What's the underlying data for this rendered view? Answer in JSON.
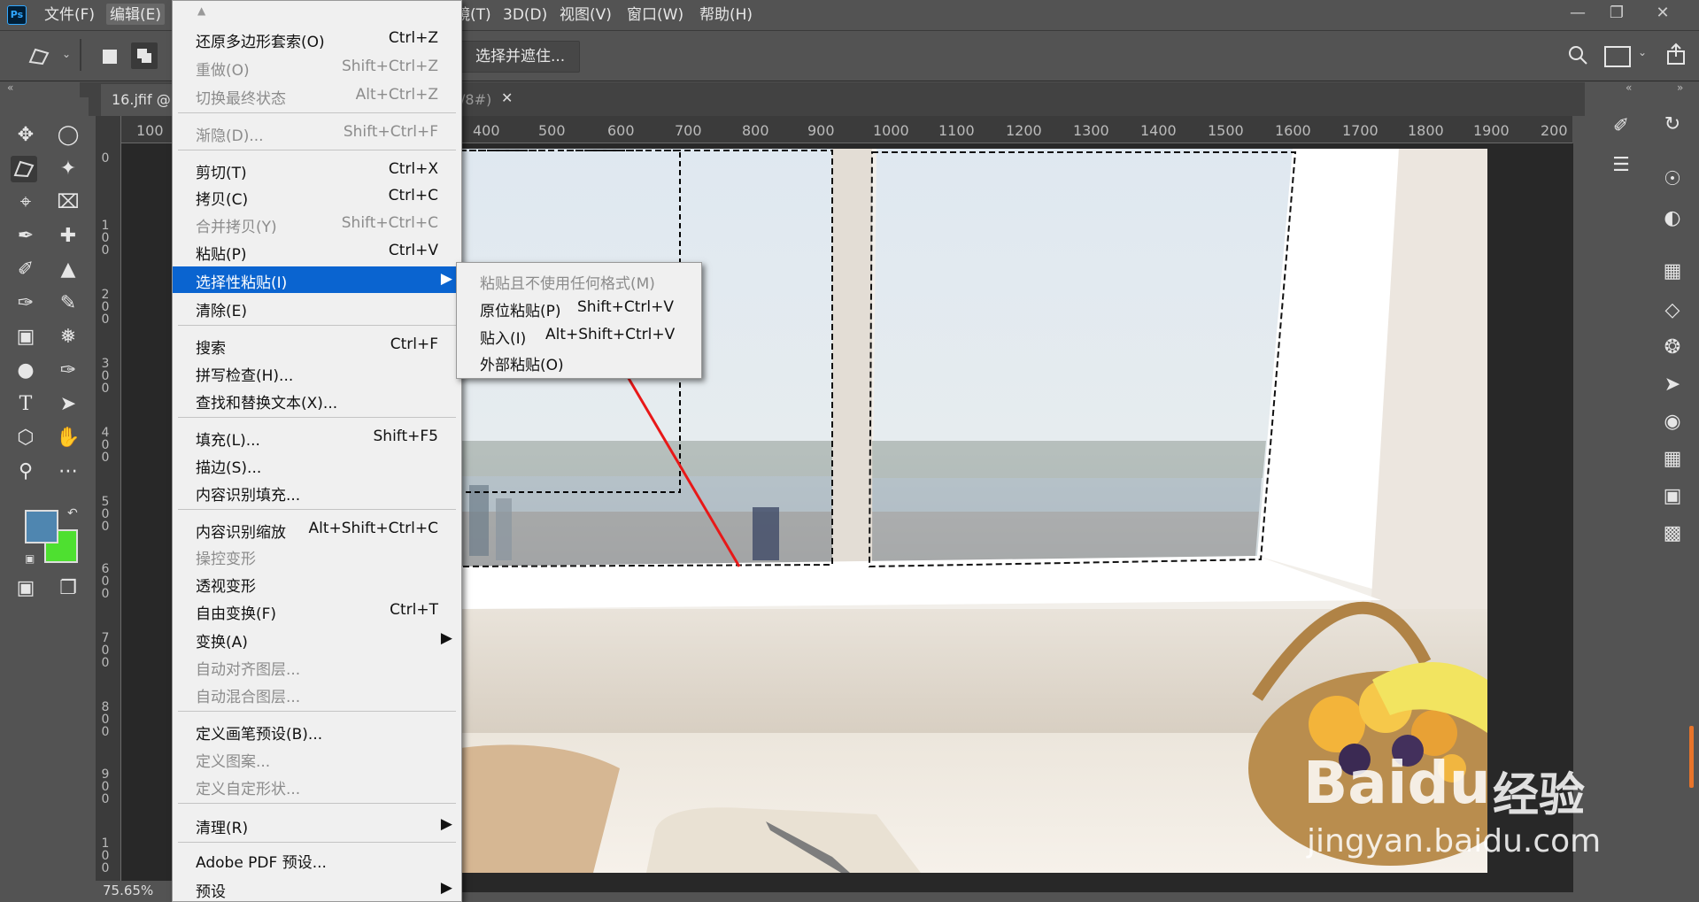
{
  "menubar": {
    "items_left": [
      "文件(F)",
      "编辑(E)"
    ],
    "items_right": [
      "镜(T)",
      "3D(D)",
      "视图(V)",
      "窗口(W)",
      "帮助(H)"
    ]
  },
  "optbar": {
    "select_mask_label": "选择并遮住..."
  },
  "document": {
    "tab_left": "16.jfif @",
    "tab_right": "/8#)",
    "zoom": "75.65%"
  },
  "ruler": {
    "h_ticks": [
      "100",
      "400",
      "500",
      "600",
      "700",
      "800",
      "900",
      "1000",
      "1100",
      "1200",
      "1300",
      "1400",
      "1500",
      "1600",
      "1700",
      "1800",
      "1900",
      "200"
    ],
    "v_ticks": [
      "0",
      "1\n0\n0",
      "2\n0\n0",
      "3\n0\n0",
      "4\n0\n0",
      "5\n0\n0",
      "6\n0\n0",
      "7\n0\n0",
      "8\n0\n0",
      "9\n0\n0",
      "1\n0\n0"
    ]
  },
  "edit_menu": {
    "items": [
      {
        "label": "还原多边形套索(O)",
        "shortcut": "Ctrl+Z"
      },
      {
        "label": "重做(O)",
        "shortcut": "Shift+Ctrl+Z"
      },
      {
        "label": "切换最终状态",
        "shortcut": "Alt+Ctrl+Z"
      },
      {
        "label": "渐隐(D)...",
        "shortcut": "Shift+Ctrl+F"
      },
      {
        "label": "剪切(T)",
        "shortcut": "Ctrl+X"
      },
      {
        "label": "拷贝(C)",
        "shortcut": "Ctrl+C"
      },
      {
        "label": "合并拷贝(Y)",
        "shortcut": "Shift+Ctrl+C"
      },
      {
        "label": "粘贴(P)",
        "shortcut": "Ctrl+V"
      },
      {
        "label": "选择性粘贴(I)",
        "shortcut": ""
      },
      {
        "label": "清除(E)",
        "shortcut": ""
      },
      {
        "label": "搜索",
        "shortcut": "Ctrl+F"
      },
      {
        "label": "拼写检查(H)...",
        "shortcut": ""
      },
      {
        "label": "查找和替换文本(X)...",
        "shortcut": ""
      },
      {
        "label": "填充(L)...",
        "shortcut": "Shift+F5"
      },
      {
        "label": "描边(S)...",
        "shortcut": ""
      },
      {
        "label": "内容识别填充...",
        "shortcut": ""
      },
      {
        "label": "内容识别缩放",
        "shortcut": "Alt+Shift+Ctrl+C"
      },
      {
        "label": "操控变形",
        "shortcut": ""
      },
      {
        "label": "透视变形",
        "shortcut": ""
      },
      {
        "label": "自由变换(F)",
        "shortcut": "Ctrl+T"
      },
      {
        "label": "变换(A)",
        "shortcut": ""
      },
      {
        "label": "自动对齐图层...",
        "shortcut": ""
      },
      {
        "label": "自动混合图层...",
        "shortcut": ""
      },
      {
        "label": "定义画笔预设(B)...",
        "shortcut": ""
      },
      {
        "label": "定义图案...",
        "shortcut": ""
      },
      {
        "label": "定义自定形状...",
        "shortcut": ""
      },
      {
        "label": "清理(R)",
        "shortcut": ""
      },
      {
        "label": "Adobe PDF 预设...",
        "shortcut": ""
      },
      {
        "label": "预设",
        "shortcut": ""
      }
    ]
  },
  "submenu": {
    "items": [
      {
        "label": "粘贴且不使用任何格式(M)",
        "shortcut": ""
      },
      {
        "label": "原位粘贴(P)",
        "shortcut": "Shift+Ctrl+V"
      },
      {
        "label": "贴入(I)",
        "shortcut": "Alt+Shift+Ctrl+V"
      },
      {
        "label": "外部粘贴(O)",
        "shortcut": ""
      }
    ]
  },
  "watermark": {
    "brand": "Bai",
    "brand2": "du",
    "cn": "经验",
    "url": "jingyan.baidu.com"
  },
  "colors": {
    "foreground": "#4f86b0",
    "background": "#4ee030",
    "highlight": "#0a64d0",
    "annotation_arrow": "#e81818"
  },
  "icons": [
    "move-icon",
    "marquee-icon",
    "polygonal-lasso-icon",
    "magic-wand-icon",
    "crop-icon",
    "frame-icon",
    "eyedropper-icon",
    "healing-icon",
    "brush-icon",
    "stamp-icon",
    "history-brush-icon",
    "eraser-icon",
    "gradient-icon",
    "blur-icon",
    "dodge-icon",
    "pen-icon",
    "type-icon",
    "path-select-icon",
    "shape-icon",
    "hand-icon",
    "zoom-icon",
    "more-icon"
  ]
}
